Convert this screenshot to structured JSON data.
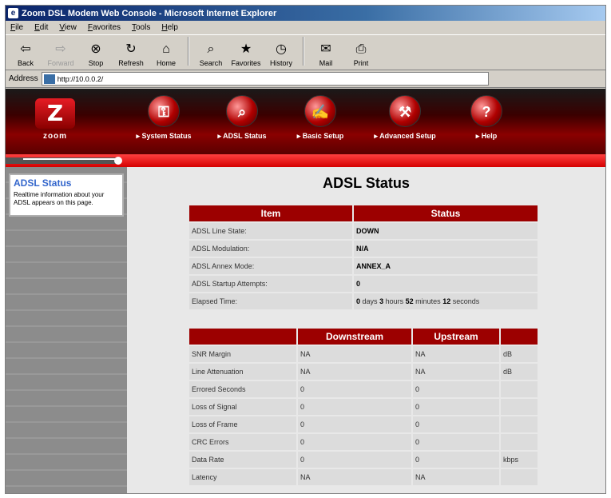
{
  "browser": {
    "title": "Zoom DSL Modem Web Console - Microsoft Internet Explorer",
    "menu": [
      "File",
      "Edit",
      "View",
      "Favorites",
      "Tools",
      "Help"
    ],
    "toolbar": [
      {
        "label": "Back",
        "icon": "back-arrow-icon",
        "glyph": "⇦",
        "enabled": true
      },
      {
        "label": "Forward",
        "icon": "forward-arrow-icon",
        "glyph": "⇨",
        "enabled": false
      },
      {
        "label": "Stop",
        "icon": "stop-icon",
        "glyph": "⊗",
        "enabled": true
      },
      {
        "label": "Refresh",
        "icon": "refresh-icon",
        "glyph": "↻",
        "enabled": true
      },
      {
        "label": "Home",
        "icon": "home-icon",
        "glyph": "⌂",
        "enabled": true
      },
      {
        "label": "Search",
        "icon": "search-icon",
        "glyph": "⌕",
        "enabled": true
      },
      {
        "label": "Favorites",
        "icon": "favorites-icon",
        "glyph": "★",
        "enabled": true
      },
      {
        "label": "History",
        "icon": "history-icon",
        "glyph": "◷",
        "enabled": true
      },
      {
        "label": "Mail",
        "icon": "mail-icon",
        "glyph": "✉",
        "enabled": true
      },
      {
        "label": "Print",
        "icon": "print-icon",
        "glyph": "⎙",
        "enabled": true
      }
    ],
    "address_label": "Address",
    "address_value": "http://10.0.0.2/"
  },
  "brand": {
    "logo_glyph": "Z",
    "logo_text": "zoom"
  },
  "nav": [
    {
      "label": "▸ System Status",
      "icon": "system-status-icon",
      "glyph": "⚿"
    },
    {
      "label": "▸ ADSL Status",
      "icon": "magnifier-icon",
      "glyph": "⌕"
    },
    {
      "label": "▸ Basic Setup",
      "icon": "wrench-hand-icon",
      "glyph": "✍"
    },
    {
      "label": "▸ Advanced Setup",
      "icon": "wrench-icon",
      "glyph": "⚒"
    },
    {
      "label": "▸ Help",
      "icon": "help-icon",
      "glyph": "?"
    }
  ],
  "sidebar": {
    "title": "ADSL Status",
    "text": "Realtime information about your ADSL appears on this page."
  },
  "page": {
    "title": "ADSL Status",
    "status_table": {
      "headers": [
        "Item",
        "Status"
      ],
      "rows": [
        {
          "item": "ADSL Line State:",
          "status": "DOWN"
        },
        {
          "item": "ADSL Modulation:",
          "status": "N/A"
        },
        {
          "item": "ADSL Annex Mode:",
          "status": "ANNEX_A"
        },
        {
          "item": "ADSL Startup Attempts:",
          "status": "0"
        }
      ],
      "elapsed_label": "Elapsed Time:",
      "elapsed": {
        "days": "0",
        "days_label": "days",
        "hours": "3",
        "hours_label": "hours",
        "minutes": "52",
        "minutes_label": "minutes",
        "seconds": "12",
        "seconds_label": "seconds"
      }
    },
    "stream_table": {
      "headers": [
        "",
        "Downstream",
        "Upstream",
        ""
      ],
      "rows": [
        {
          "label": "SNR Margin",
          "down": "NA",
          "up": "NA",
          "unit": "dB"
        },
        {
          "label": "Line Attenuation",
          "down": "NA",
          "up": "NA",
          "unit": "dB"
        },
        {
          "label": "Errored Seconds",
          "down": "0",
          "up": "0",
          "unit": ""
        },
        {
          "label": "Loss of Signal",
          "down": "0",
          "up": "0",
          "unit": ""
        },
        {
          "label": "Loss of Frame",
          "down": "0",
          "up": "0",
          "unit": ""
        },
        {
          "label": "CRC Errors",
          "down": "0",
          "up": "0",
          "unit": ""
        },
        {
          "label": "Data Rate",
          "down": "0",
          "up": "0",
          "unit": "kbps"
        },
        {
          "label": "Latency",
          "down": "NA",
          "up": "NA",
          "unit": ""
        }
      ]
    }
  }
}
